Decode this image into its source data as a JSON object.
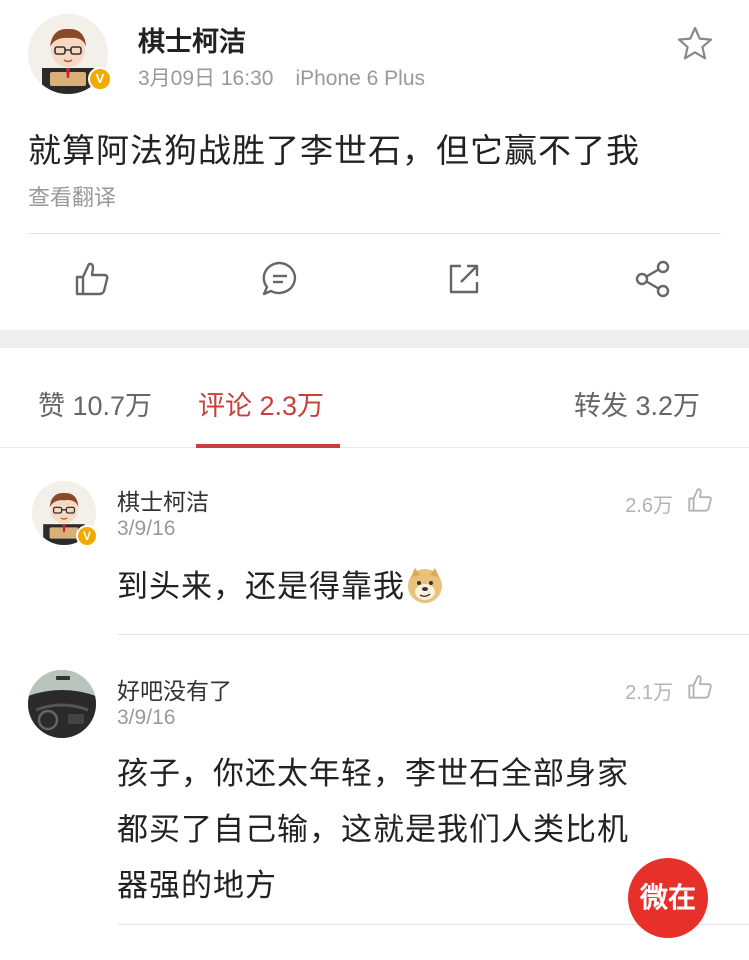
{
  "post": {
    "author": "棋士柯洁",
    "verified_badge": "V",
    "date": "3月09日 16:30",
    "device": "iPhone 6 Plus",
    "text": "就算阿法狗战胜了李世石，但它赢不了我",
    "translate_label": "查看翻译",
    "icons": [
      "star-icon",
      "thumbs-up-icon",
      "comment-icon",
      "repost-icon",
      "share-icon"
    ]
  },
  "tabs": {
    "likes": "赞 10.7万",
    "comments": "评论 2.3万",
    "reposts": "转发 3.2万",
    "active": "comments",
    "accent_color": "#c9403a"
  },
  "comments": [
    {
      "name": "棋士柯洁",
      "date": "3/9/16",
      "likes": "2.6万",
      "text": "到头来，还是得靠我",
      "emoji": "doge-emoji-icon"
    },
    {
      "name": "好吧没有了",
      "date": "3/9/16",
      "likes": "2.1万",
      "text_lines": [
        "孩子，你还太年轻，李世石全部身家",
        "都买了自己输，这就是我们人类比机",
        "器强的地方"
      ]
    }
  ],
  "watermark": {
    "label": "微在",
    "color": "#e8302a"
  }
}
